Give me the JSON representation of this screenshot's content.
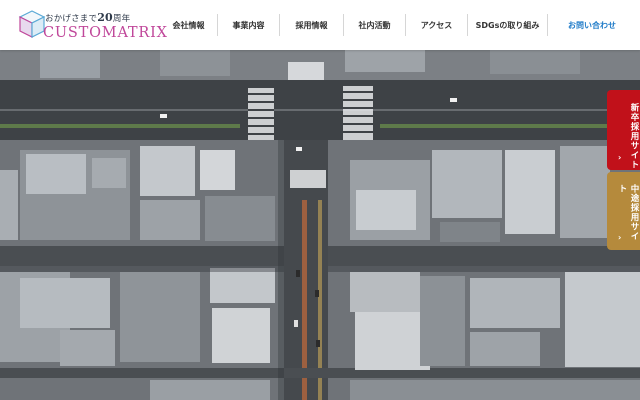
{
  "header": {
    "logo": {
      "tagline_prefix": "おかげさまで",
      "tagline_number": "20",
      "tagline_suffix": "周年",
      "wordmark": "CUSTOMATRIX"
    },
    "nav": [
      {
        "label": "会社情報"
      },
      {
        "label": "事業内容"
      },
      {
        "label": "採用情報"
      },
      {
        "label": "社内活動"
      },
      {
        "label": "アクセス"
      },
      {
        "label": "SDGsの取り組み"
      },
      {
        "label": "お問い合わせ"
      }
    ]
  },
  "side_tabs": {
    "new_grad": {
      "label": "新卒採用サイト",
      "arrow": "›",
      "color": "#c1111a"
    },
    "mid_career": {
      "label": "中途採用サイト",
      "arrow": "›",
      "color": "#b58a3c"
    }
  },
  "colors": {
    "brand_pink": "#c0479a",
    "contact_blue": "#1f7bc8"
  }
}
